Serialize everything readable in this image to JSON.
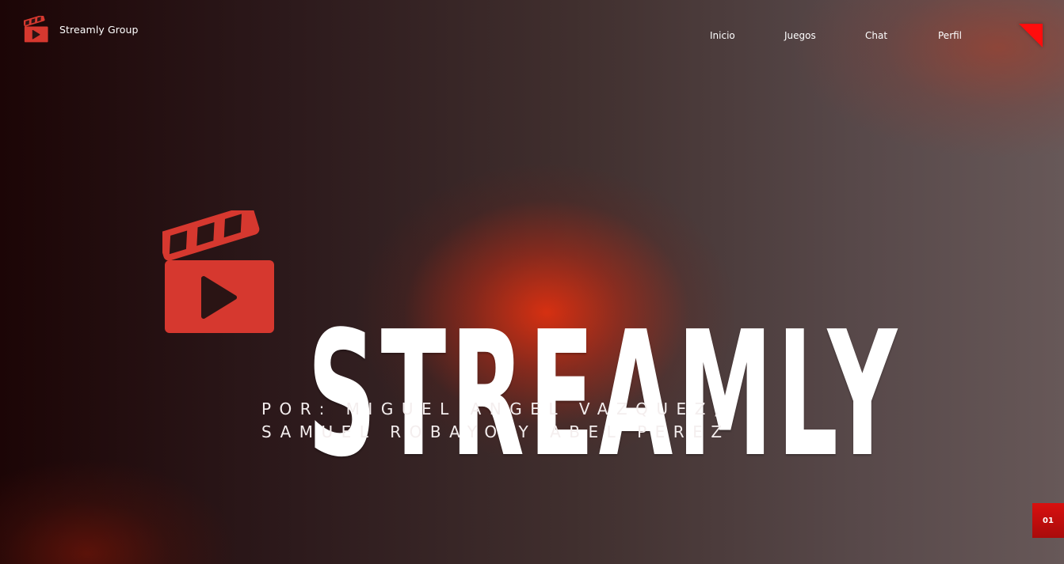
{
  "header": {
    "brand_icon": "clapperboard-play-icon",
    "brand_name": "Streamly Group",
    "nav": [
      {
        "label": "Inicio"
      },
      {
        "label": "Juegos"
      },
      {
        "label": "Chat"
      },
      {
        "label": "Perfil"
      }
    ],
    "menu_icon": "red-corner-triangle-icon"
  },
  "hero": {
    "logo_icon": "clapperboard-play-icon",
    "title": "STREAMLY",
    "authors_line1": "POR: MIGUEL ANGEL VAZQUEZ,",
    "authors_line2": "SAMUEL ROBAYO Y ABEL PEREZ"
  },
  "page_badge": "01",
  "colors": {
    "accent_red": "#d6382f",
    "triangle_red": "#ff0d0d",
    "badge_red": "#c90e0e",
    "glow_orange": "#de3010",
    "text": "#ffffff"
  }
}
